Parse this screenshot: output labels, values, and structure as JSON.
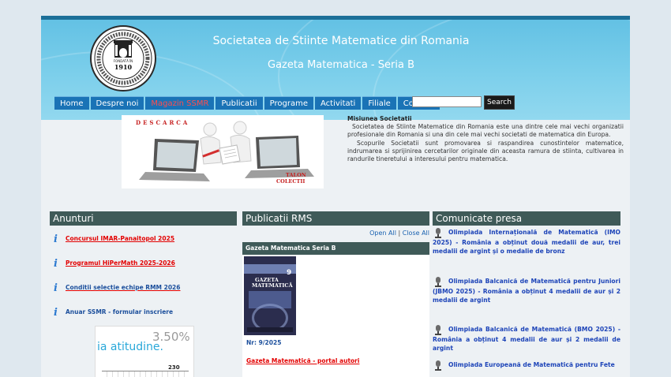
{
  "header": {
    "title": "Societatea de Stiinte Matematice din Romania",
    "subtitle": "Gazeta Matematica - Seria B",
    "logo": {
      "year": "1910",
      "founded_label": "FONDATĂ ÎN",
      "ring_text": "SOCIETATEA DE ȘTIINȚE MATEMATICE DIN ROMÂNIA"
    }
  },
  "nav": {
    "items": [
      {
        "label": "Home"
      },
      {
        "label": "Despre noi"
      },
      {
        "label": "Magazin SSMR"
      },
      {
        "label": "Publicatii"
      },
      {
        "label": "Programe"
      },
      {
        "label": "Activitati"
      },
      {
        "label": "Filiale"
      },
      {
        "label": "Contact"
      }
    ]
  },
  "search": {
    "button_label": "Search",
    "placeholder": ""
  },
  "promo": {
    "top_text": "DESCARCA",
    "bottom_text_1": "TALON",
    "bottom_text_2": "COLECTII"
  },
  "mission": {
    "title": "Misiunea Societatii",
    "p1": "Societatea de Stiinte Matematice din Romania este una dintre cele mai vechi organizatii profesionale din Romania si una din cele mai vechi societati de matematica din Europa.",
    "p2": "Scopurile Societatii sunt promovarea si raspandirea cunostintelor matematice, indrumarea si sprijinirea cercetarilor originale din aceasta ramura de stiinta, cultivarea in randurile tineretului a interesului pentru matematica."
  },
  "anunturi": {
    "heading": "Anunturi",
    "items": [
      {
        "label": "Concursul IMAR-Panaitopol 2025"
      },
      {
        "label": "Programul HiPerMath 2025-2026"
      },
      {
        "label": "Conditii selectie echipe RMM 2026"
      },
      {
        "label": "Anuar SSMR - formular inscriere"
      }
    ],
    "banner": {
      "percent": "3.50%",
      "text": "ia atitudine.",
      "number": "230"
    }
  },
  "publicatii": {
    "heading": "Publicatii RMS",
    "open_all": "Open All",
    "separator": "|",
    "close_all": "Close All",
    "section_title": "Gazeta Matematica Seria B",
    "cover": {
      "title_line1": "GAZETA",
      "title_line2": "MATEMATICĂ",
      "number": "9"
    },
    "issue": "Nr: 9/2025",
    "portal_link": "Gazeta Matematică - portal autori"
  },
  "comunicate": {
    "heading": "Comunicate presa",
    "items": [
      {
        "text": "Olimpiada Internațională de Matematică (IMO 2025) - România a obținut două medalii de aur, trei medalii de argint și o medalie de bronz"
      },
      {
        "text": "Olimpiada Balcanică de Matematică pentru Juniori (JBMO 2025) - România a obținut 4 medalii de aur și 2 medalii de argint"
      },
      {
        "text": "Olimpiada Balcanică de Matematică (BMO 2025) - România a obținut 4 medalii de aur și 2 medalii de argint"
      },
      {
        "text": "Olimpiada Europeană de Matematică pentru Fete"
      }
    ]
  },
  "colors": {
    "header_blue": "#63c1e4",
    "nav_blue": "#1a73b6",
    "section_header": "#3f5a58",
    "link_red": "#e30000",
    "press_blue": "#1d44b8"
  }
}
